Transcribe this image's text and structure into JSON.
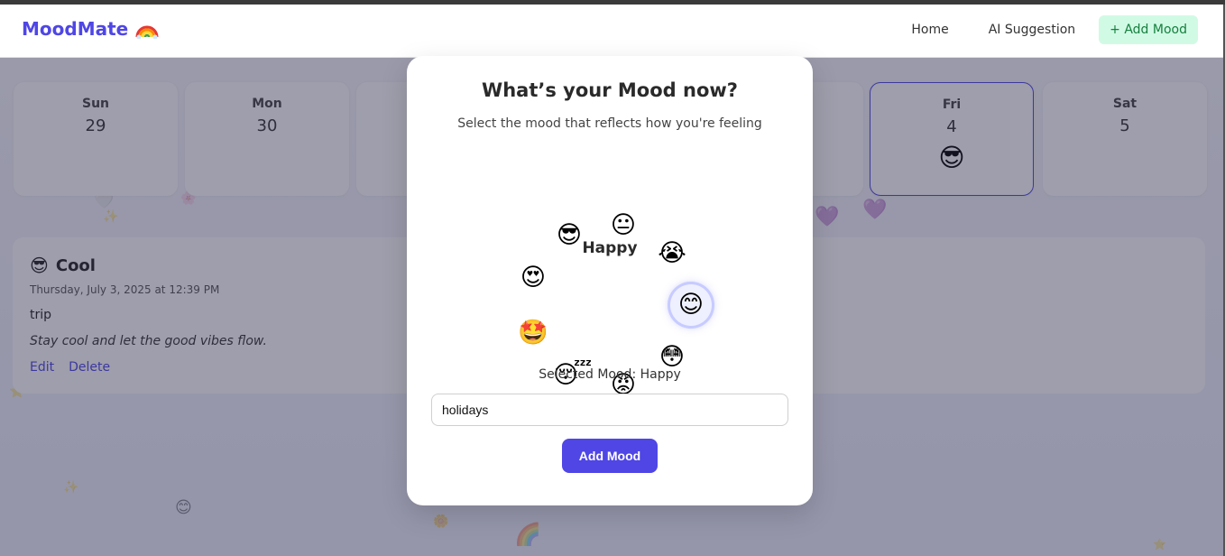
{
  "navbar": {
    "brand": "MoodMate",
    "links": [
      {
        "label": "Home"
      },
      {
        "label": "AI Suggestion"
      },
      {
        "label": "+ Add Mood"
      }
    ]
  },
  "week": [
    {
      "day": "Sun",
      "date": "29",
      "emoji": ""
    },
    {
      "day": "Mon",
      "date": "30",
      "emoji": ""
    },
    {
      "day": "Fri",
      "date": "4",
      "emoji": "😎"
    },
    {
      "day": "Sat",
      "date": "5",
      "emoji": ""
    }
  ],
  "entry": {
    "emoji": "😎",
    "mood": "Cool",
    "date": "Thursday, July 3, 2025 at 12:39 PM",
    "text": "trip",
    "quote": "Stay cool and let the good vibes flow.",
    "edit_label": "Edit",
    "delete_label": "Delete"
  },
  "modal": {
    "title": "What’s your Mood now?",
    "subtitle": "Select the mood that reflects how you're feeling",
    "center_label": "Happy",
    "moods": [
      "😐",
      "😭",
      "😊",
      "😳",
      "😡",
      "😴",
      "🤩",
      "😍",
      "😎"
    ],
    "active_mood": "😊",
    "selected_text": "Selected Mood: Happy",
    "input_value": "holidays",
    "button_label": "Add Mood"
  },
  "colors": {
    "accent": "#4f46e5",
    "add_button_bg": "#d1fae5",
    "add_button_text": "#15803d"
  }
}
